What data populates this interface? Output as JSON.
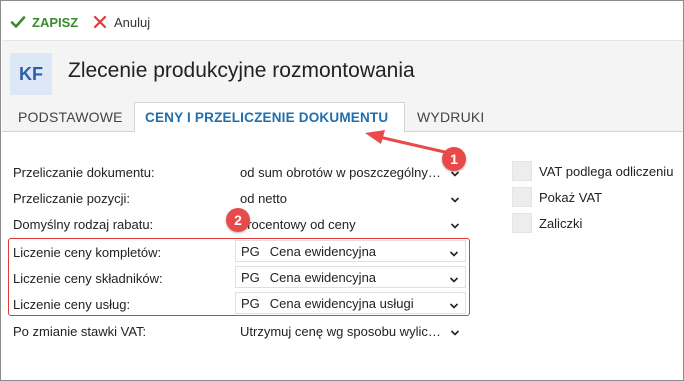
{
  "toolbar": {
    "save_label": "ZAPISZ",
    "cancel_label": "Anuluj"
  },
  "header": {
    "badge": "KF",
    "title": "Zlecenie produkcyjne rozmontowania"
  },
  "tabs": [
    {
      "label": "PODSTAWOWE",
      "active": false
    },
    {
      "label": "CENY I PRZELICZENIE DOKUMENTU",
      "active": true
    },
    {
      "label": "WYDRUKI",
      "active": false
    }
  ],
  "form": {
    "rows": [
      {
        "label": "Przeliczanie dokumentu:",
        "value": "od sum obrotów w poszczególnyc..."
      },
      {
        "label": "Przeliczanie pozycji:",
        "value": "od netto"
      },
      {
        "label": "Domyślny rodzaj rabatu:",
        "value": "procentowy od ceny"
      },
      {
        "label": "Liczenie ceny kompletów:",
        "code": "PG",
        "value": "Cena ewidencyjna"
      },
      {
        "label": "Liczenie ceny składników:",
        "code": "PG",
        "value": "Cena ewidencyjna"
      },
      {
        "label": "Liczenie ceny usług:",
        "code": "PG",
        "value": "Cena ewidencyjna usługi"
      },
      {
        "label": "Po zmianie stawki VAT:",
        "value": "Utrzymuj cenę wg sposobu wylicza..."
      }
    ]
  },
  "checkboxes": [
    {
      "label": "VAT podlega odliczeniu",
      "checked": false
    },
    {
      "label": "Pokaż VAT",
      "checked": false
    },
    {
      "label": "Zaliczki",
      "checked": false
    }
  ],
  "annotations": {
    "badge_1": "1",
    "badge_2": "2",
    "color": "#e84a4a"
  },
  "colors": {
    "accent": "#1f6fae",
    "save_green": "#3a8a2a",
    "cancel_red": "#e03a3a"
  }
}
